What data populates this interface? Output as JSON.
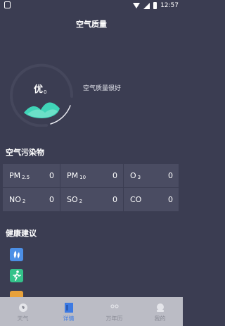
{
  "status_bar": {
    "time": "12:57",
    "icons": [
      "app-icon",
      "wifi-icon",
      "signal-icon",
      "battery-icon"
    ]
  },
  "header": {
    "title": "空气质量"
  },
  "aqi": {
    "level": "优",
    "value": "0",
    "description": "空气质量很好",
    "accent_color": "#40d4b8"
  },
  "pollutants": {
    "title": "空气污染物",
    "items": [
      {
        "name": "PM",
        "sub": "2.5",
        "value": "0"
      },
      {
        "name": "PM",
        "sub": "10",
        "value": "0"
      },
      {
        "name": "O",
        "sub": "3",
        "value": "0"
      },
      {
        "name": "NO",
        "sub": "2",
        "value": "0"
      },
      {
        "name": "SO",
        "sub": "2",
        "value": "0"
      },
      {
        "name": "CO",
        "sub": "",
        "value": "0"
      }
    ]
  },
  "health": {
    "title": "健康建议",
    "icons": [
      "leaf-icon",
      "running-icon",
      "mask-icon"
    ]
  },
  "bottom_nav": {
    "active_color": "#3e7be3",
    "tabs": [
      {
        "label": "天气",
        "icon": "weather-icon"
      },
      {
        "label": "详情",
        "icon": "details-icon"
      },
      {
        "label": "万年历",
        "icon": "calendar-icon"
      },
      {
        "label": "我的",
        "icon": "profile-icon"
      }
    ]
  }
}
